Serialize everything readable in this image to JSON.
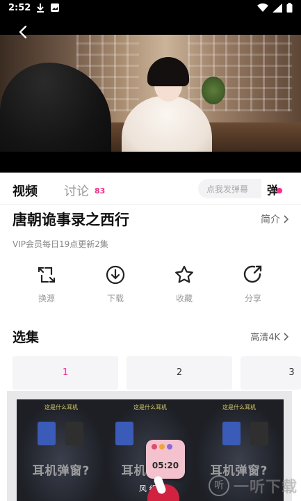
{
  "status_bar": {
    "time": "2:52",
    "left_icons": [
      "download-icon",
      "image-icon"
    ],
    "right_icons": [
      "wifi-icon",
      "signal-icon",
      "battery-icon"
    ]
  },
  "player": {
    "back_icon": "back-arrow-icon"
  },
  "tabs": {
    "video_label": "视频",
    "discuss_label": "讨论",
    "discuss_count": "83",
    "danmu_placeholder": "点我发弹幕",
    "danmu_toggle_label": "弹"
  },
  "drama": {
    "title": "唐朝诡事录之西行",
    "intro_label": "简介",
    "update_info": "VIP会员每日19点更新2集"
  },
  "actions": [
    {
      "label": "换源",
      "icon": "switch-source-icon"
    },
    {
      "label": "下载",
      "icon": "download-icon"
    },
    {
      "label": "收藏",
      "icon": "star-icon"
    },
    {
      "label": "分享",
      "icon": "share-icon"
    }
  ],
  "episodes": {
    "title": "选集",
    "quality_label": "高清4K",
    "items": [
      "1",
      "2",
      "3"
    ],
    "active_index": 0
  },
  "ad": {
    "captions": [
      "这是什么耳机",
      "这是什么耳机",
      "这是什么耳机"
    ],
    "big_texts": [
      "耳机弹窗?",
      "耳机弹窗?",
      "耳机弹窗?"
    ],
    "widget_time": "05:20",
    "widget_label": "风  组件"
  },
  "watermark": {
    "logo": "听",
    "text": "一听下载"
  },
  "colors": {
    "accent_pink": "#ff2d8a",
    "status_bar_bg": "#000000",
    "muted_text": "#999999"
  }
}
